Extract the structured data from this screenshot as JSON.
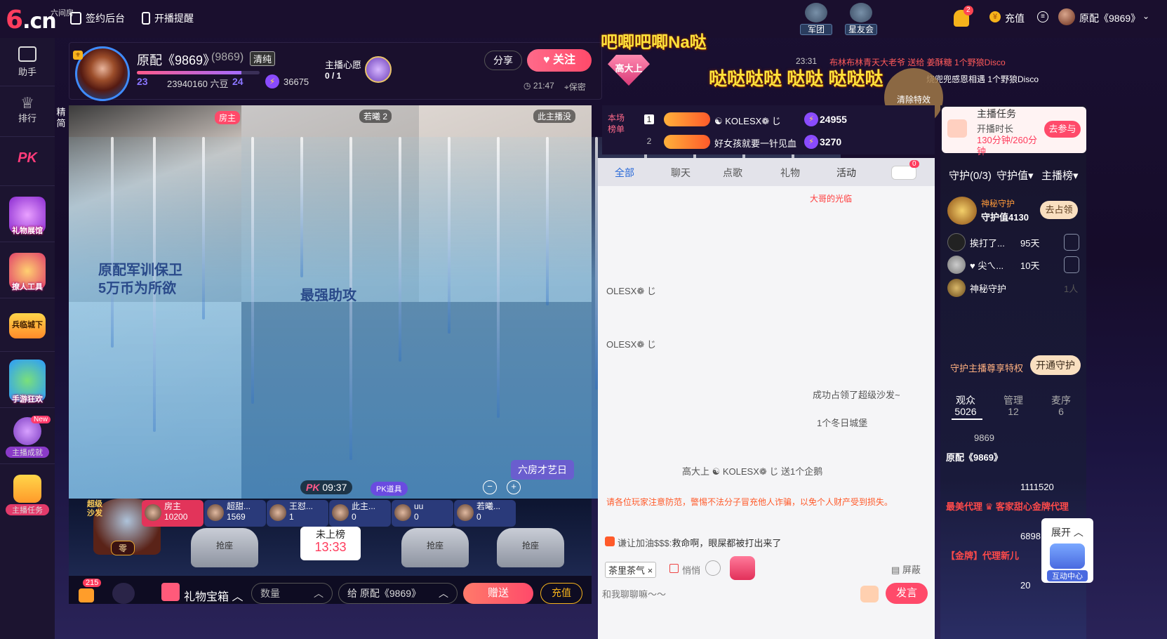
{
  "brand": {
    "logo_text": ".cn",
    "logo_six": "6",
    "logo_sub": "六间房"
  },
  "topbar": {
    "sign_backend": "签约后台",
    "live_reminder": "开播提醒",
    "legion": "军团",
    "star_club": "星友会",
    "bell_count": "2",
    "recharge": "充值",
    "username": "原配《9869》",
    "coin_icon": "coin-icon"
  },
  "sidebar": {
    "items": [
      {
        "label": "助手",
        "icon": "assistant-icon"
      },
      {
        "label": "排行",
        "icon": "crown-icon"
      },
      {
        "label": "PK",
        "icon": "pk-icon"
      },
      {
        "label": "礼物展馆",
        "icon": "gift-hall-icon"
      },
      {
        "label": "撩人工具",
        "icon": "flirt-tool-icon"
      },
      {
        "label": "兵临城下",
        "icon": "siege-game-icon"
      },
      {
        "label": "手游狂欢",
        "icon": "mobile-game-icon"
      },
      {
        "label": "主播成就",
        "icon": "anchor-achievement-icon",
        "badge": "New"
      },
      {
        "label": "主播任务",
        "icon": "anchor-task-icon"
      }
    ]
  },
  "anchor": {
    "name": "原配《9869》",
    "room_id": "(9869)",
    "quality": "清纯",
    "level1": "23",
    "beans": "23940160 六豆",
    "level2": "24",
    "energy": "36675",
    "wish_title": "主播心愿",
    "wish_count": "0 / 1",
    "share": "分享",
    "follow": "关注",
    "timer": "21:47",
    "privacy": "保密",
    "exp_progress": 0.85
  },
  "effects": {
    "line1": "吧唧吧唧Na哒",
    "line2": "哒哒哒哒 哒哒 哒哒哒",
    "badge": "高大上",
    "msg_time": "23:31",
    "msg1": "布林布林青天大老爷 送给 姜酥糖 1个野狼Disco",
    "msg2": "烧兜兜感恩相遇 1个野狼Disco",
    "clear": "清除特效"
  },
  "video": {
    "host_tag": "房主",
    "guest_tag": "若曦 2",
    "mic_tag": "此主播没",
    "side_toggle": "精简",
    "sign1": "原配军训保卫",
    "sign1b": "5万币为所欲",
    "sign2": "最强助攻",
    "pk_time": "09:37",
    "pk_boost": "PK道具",
    "talent": "六房才艺日",
    "zoom_out": "−",
    "zoom_in": "+"
  },
  "seats": {
    "sofa_label": "超级沙发",
    "sofa_name": "零",
    "chips": [
      {
        "name": "房主",
        "value": "10200"
      },
      {
        "name": "超甜...",
        "value": "1569"
      },
      {
        "name": "王怼...",
        "value": "1"
      },
      {
        "name": "此主...",
        "value": "0"
      },
      {
        "name": "uu",
        "value": "0"
      },
      {
        "name": "若曦...",
        "value": "0"
      }
    ],
    "grab": "抢座",
    "unranked_label": "未上榜",
    "unranked_time": "13:33"
  },
  "bottom": {
    "bag_count": "215",
    "gift_box": "礼物宝箱",
    "qty_placeholder": "数量",
    "to": "给 原配《9869》",
    "send": "赠送",
    "recharge": "充值"
  },
  "rank": {
    "title": "本场榜单",
    "rows": [
      {
        "no": "1",
        "name": "☯ KOLESX❁ じ",
        "value": "24955"
      },
      {
        "no": "2",
        "name": "好女孩就要一针见血",
        "value": "3270"
      }
    ]
  },
  "chat": {
    "tabs": [
      "全部",
      "聊天",
      "点歌",
      "礼物",
      "活动"
    ],
    "car_count": "0",
    "welcome": "大哥的光临",
    "lines": [
      {
        "text": "OLESX❁ じ"
      },
      {
        "text": "OLESX❁ じ"
      },
      {
        "text": "成功占领了超级沙发~"
      },
      {
        "text": "1个冬日城堡"
      },
      {
        "text": "高大上 ☯ KOLESX❁ じ 送1个企鹅"
      }
    ],
    "notice": "请各位玩家注意防范，警惕不法分子冒充他人诈骗，以免个人财产受到损失。",
    "cheer_user": "谦让加油$$$:",
    "cheer_text": "救命啊，眼屎都被打出来了",
    "tag": "茶里茶气 ×",
    "quiet": "悄悄",
    "shield": "屏蔽",
    "input_placeholder": "和我聊聊嘛～～",
    "send": "发言"
  },
  "right": {
    "task_title": "主播任务",
    "task_line1": "开播时长",
    "task_line2": "130分钟/260分",
    "task_line3": "钟",
    "task_btn": "去参与",
    "tabs": [
      "守护(0/3)",
      "守护值▾",
      "主播榜▾"
    ],
    "mystery_name": "神秘守护",
    "guard_value": "守护值4130",
    "occupy": "去占领",
    "guards": [
      {
        "name": "挨打了...",
        "days": "95天"
      },
      {
        "name": "♥ 尖ㄟ...",
        "days": "10天"
      },
      {
        "name": "神秘守护",
        "days": "1人"
      }
    ],
    "privilege": "守护主播尊享特权",
    "open_guard": "开通守护",
    "aud_tabs": [
      {
        "label": "观众",
        "count": "5026"
      },
      {
        "label": "管理",
        "count": "12"
      },
      {
        "label": "麦序",
        "count": "6"
      }
    ],
    "audience": [
      {
        "name": "9869"
      },
      {
        "name": "原配《9869》"
      },
      {
        "name": "1111520"
      },
      {
        "name": "最美代理 ♛ 客家甜心金牌代理"
      },
      {
        "name": "6898"
      },
      {
        "name": "【金牌】代理新儿"
      },
      {
        "name": "20"
      }
    ],
    "expand": "展开 ︿",
    "interact": "互动中心"
  }
}
